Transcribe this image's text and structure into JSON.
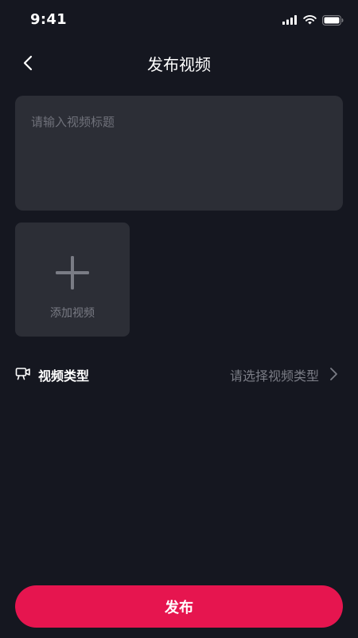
{
  "status_bar": {
    "time": "9:41",
    "icons": [
      "signal-icon",
      "wifi-icon",
      "battery-icon"
    ]
  },
  "header": {
    "back_icon": "chevron-left-icon",
    "title": "发布视频"
  },
  "title_input": {
    "placeholder": "请输入视频标题",
    "value": ""
  },
  "add_video": {
    "icon": "plus-icon",
    "label": "添加视频"
  },
  "video_type": {
    "icon": "camera-icon",
    "label": "视频类型",
    "placeholder": "请选择视频类型",
    "chevron_icon": "chevron-right-icon"
  },
  "footer": {
    "publish_label": "发布"
  },
  "colors": {
    "background": "#151720",
    "card": "#2c2e36",
    "muted_text": "#7a7c85",
    "accent": "#e6154f"
  }
}
